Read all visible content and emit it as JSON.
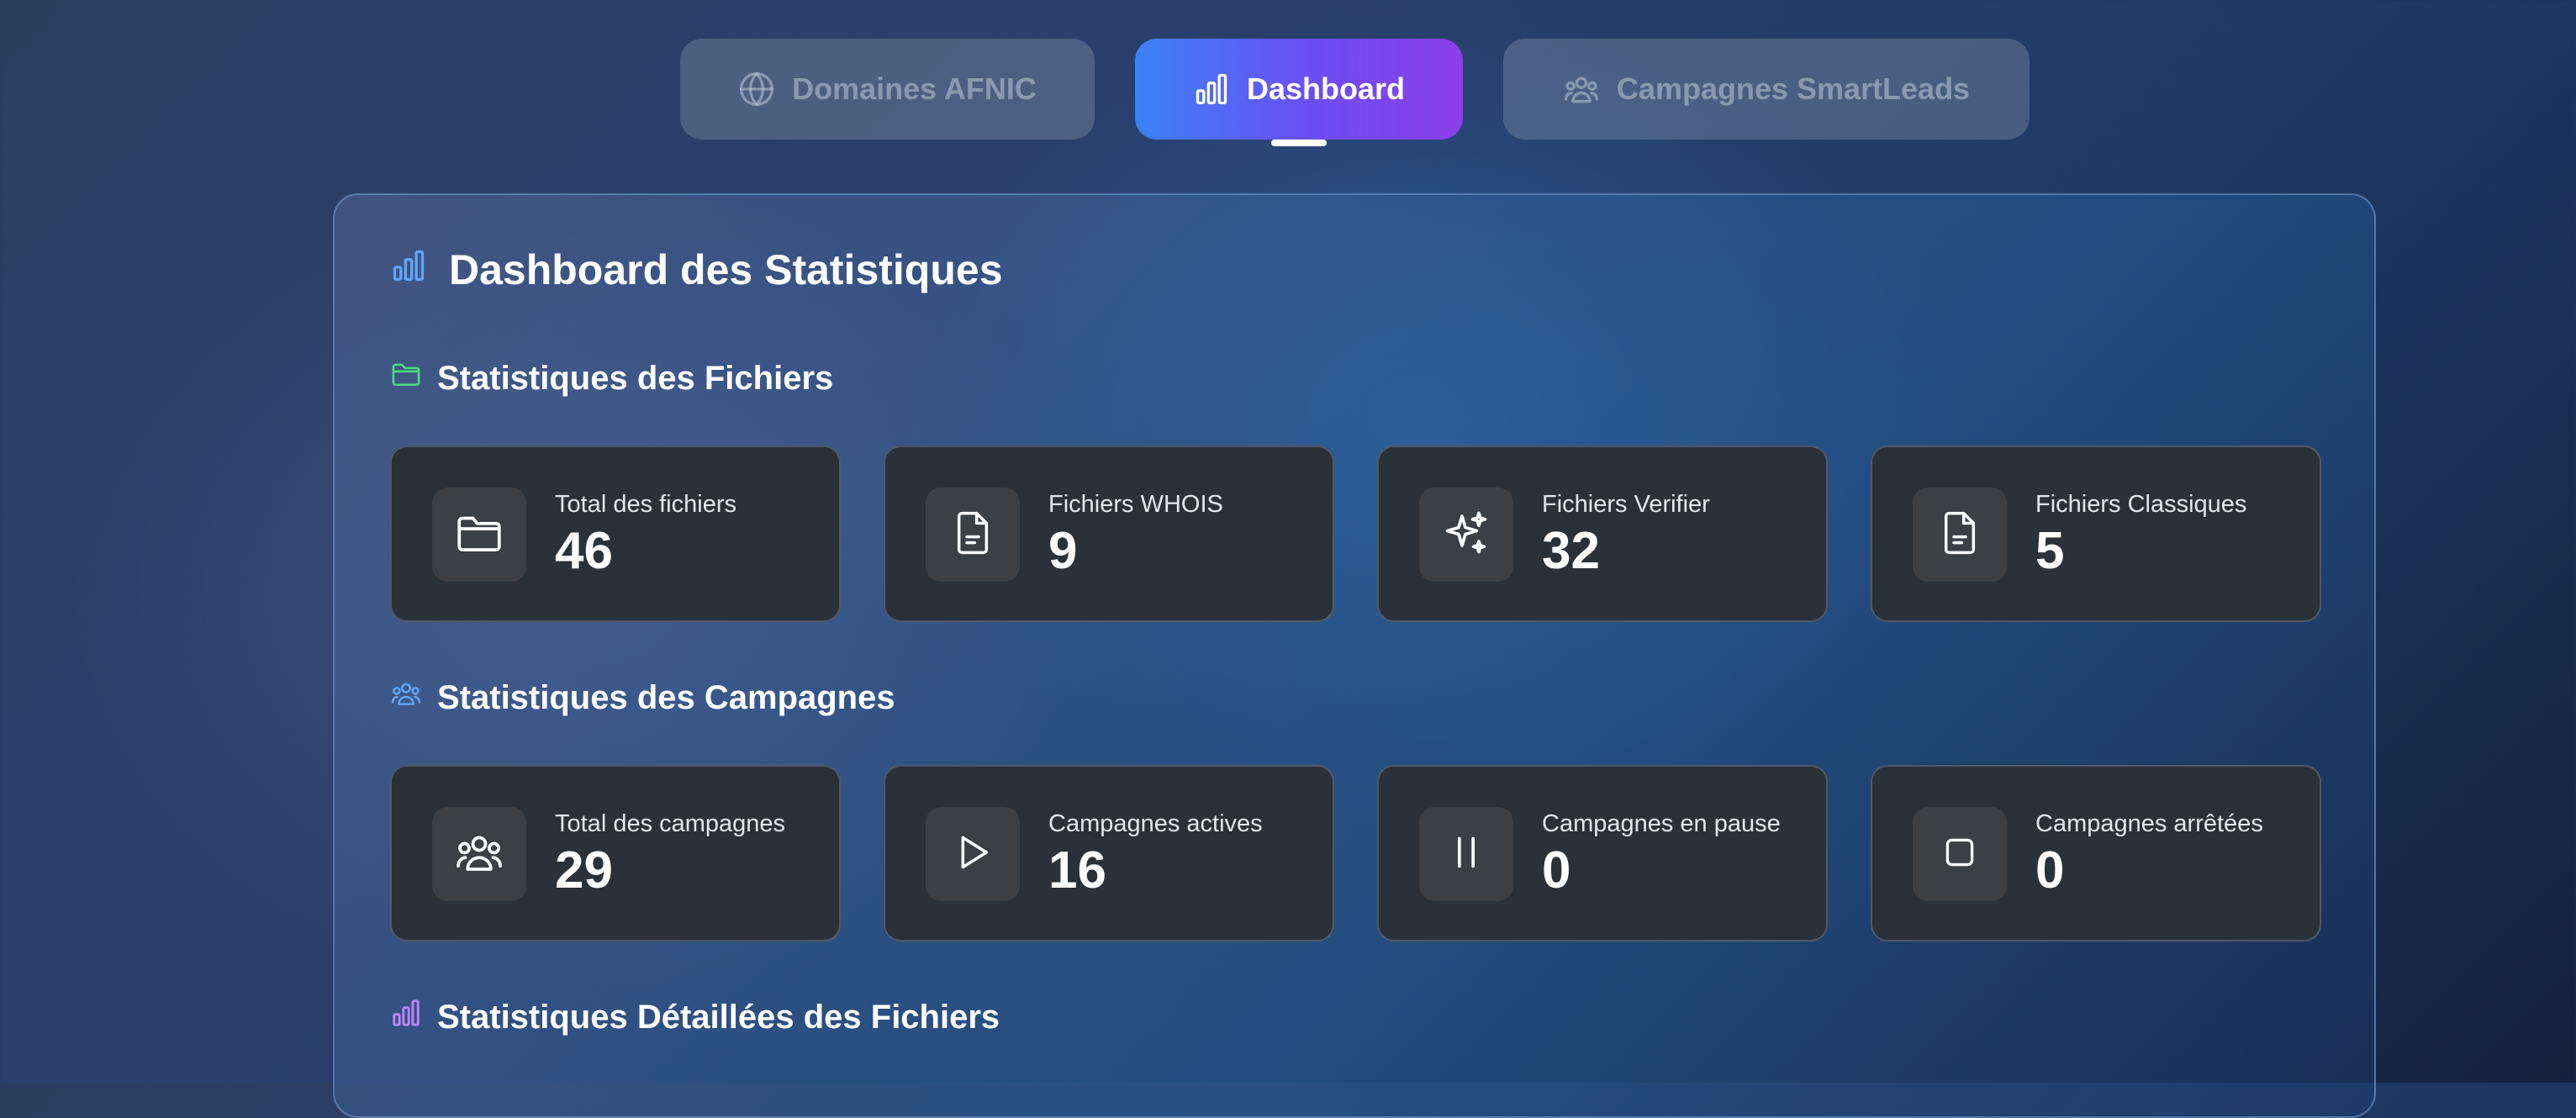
{
  "tabs": [
    {
      "label": "Domaines AFNIC",
      "icon": "globe-icon",
      "active": false
    },
    {
      "label": "Dashboard",
      "icon": "bar-chart-icon",
      "active": true
    },
    {
      "label": "Campagnes SmartLeads",
      "icon": "users-icon",
      "active": false
    }
  ],
  "dashboard": {
    "title": "Dashboard des Statistiques",
    "files_section": {
      "title": "Statistiques des Fichiers",
      "cards": [
        {
          "label": "Total des fichiers",
          "value": "46",
          "icon": "folder-icon"
        },
        {
          "label": "Fichiers WHOIS",
          "value": "9",
          "icon": "file-icon"
        },
        {
          "label": "Fichiers Verifier",
          "value": "32",
          "icon": "sparkles-icon"
        },
        {
          "label": "Fichiers Classiques",
          "value": "5",
          "icon": "file-icon"
        }
      ]
    },
    "campaigns_section": {
      "title": "Statistiques des Campagnes",
      "cards": [
        {
          "label": "Total des campagnes",
          "value": "29",
          "icon": "users-icon"
        },
        {
          "label": "Campagnes actives",
          "value": "16",
          "icon": "play-icon"
        },
        {
          "label": "Campagnes en pause",
          "value": "0",
          "icon": "pause-icon"
        },
        {
          "label": "Campagnes arrêtées",
          "value": "0",
          "icon": "stop-icon"
        }
      ]
    },
    "detailed_section": {
      "title": "Statistiques Détaillées des Fichiers"
    }
  },
  "colors": {
    "tab_active_gradient": [
      "#3b82f6",
      "#8b3fe8"
    ],
    "files_icon": "#4ade80",
    "campaigns_icon": "#60a5fa",
    "detailed_icon": "#c084fc",
    "title_icon": "#60a5fa",
    "card_bg": "#2b3139"
  }
}
